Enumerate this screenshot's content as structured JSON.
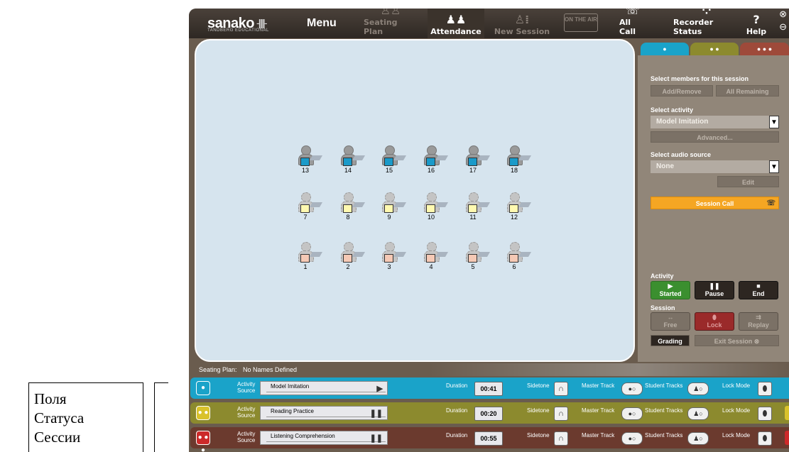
{
  "annotation": {
    "lines": [
      "Поля",
      "Статуса",
      "Сессии"
    ]
  },
  "topbar": {
    "logo": "sanako",
    "logo_sub": "TANDBERG EDUCATIONAL",
    "menu": "Menu",
    "nav": [
      {
        "label": "Seating Plan",
        "icon": "seating-plan-icon",
        "state": "dim"
      },
      {
        "label": "Attendance",
        "icon": "attendance-icon",
        "state": "active"
      },
      {
        "label": "New Session",
        "icon": "new-session-icon",
        "state": "dim"
      },
      {
        "label": "All Call",
        "icon": "all-call-icon",
        "state": "normal"
      },
      {
        "label": "Recorder Status",
        "icon": "recorder-status-icon",
        "state": "normal"
      },
      {
        "label": "Help",
        "icon": "help-icon",
        "state": "normal"
      }
    ],
    "onair": "ON THE AIR"
  },
  "seating": {
    "rows": [
      {
        "color": "#1a9ac9",
        "style": "solid",
        "numbers": [
          "13",
          "14",
          "15",
          "16",
          "17",
          "18"
        ]
      },
      {
        "color": "#fff9b0",
        "style": "dotted",
        "numbers": [
          "7",
          "8",
          "9",
          "10",
          "11",
          "12"
        ]
      },
      {
        "color": "#f5c9b5",
        "style": "dotted",
        "numbers": [
          "1",
          "2",
          "3",
          "4",
          "5",
          "6"
        ]
      }
    ],
    "footer_label": "Seating Plan:",
    "footer_value": "No Names Defined"
  },
  "right_panel": {
    "tabs": [
      "●",
      "● ●",
      "● ● ●"
    ],
    "select_members_label": "Select members for this session",
    "add_remove": "Add/Remove",
    "all_remaining": "All Remaining",
    "select_activity_label": "Select activity",
    "activity_value": "Model Imitation",
    "advanced": "Advanced...",
    "select_audio_label": "Select audio source",
    "audio_value": "None",
    "edit": "Edit",
    "session_call": "Session Call",
    "activity_heading": "Activity",
    "started": "Started",
    "pause": "Pause",
    "end": "End",
    "session_heading": "Session",
    "free": "Free",
    "lock": "Lock",
    "replay": "Replay",
    "grading": "Grading",
    "exit_session": "Exit Session"
  },
  "sessions": [
    {
      "color": "#1aa3c9",
      "badge": "●",
      "activity": "Model Imitation",
      "ctrl": "▶",
      "duration": "00:41",
      "edge": "#1aa3c9"
    },
    {
      "color": "#8c8a2e",
      "badge": "● ●",
      "activity": "Reading Practice",
      "ctrl": "❚❚",
      "duration": "00:20",
      "edge": "#d9c22b"
    },
    {
      "color": "#6b3a2e",
      "badge": "● ● ●",
      "activity": "Listening Comprehension",
      "ctrl": "❚❚",
      "duration": "00:55",
      "edge": "#cc2a2a"
    }
  ],
  "session_labels": {
    "activity": "Activity",
    "source": "Source",
    "duration": "Duration",
    "sidetone": "Sidetone",
    "master_track": "Master Track",
    "student_tracks": "Student Tracks",
    "lock_mode": "Lock Mode"
  }
}
